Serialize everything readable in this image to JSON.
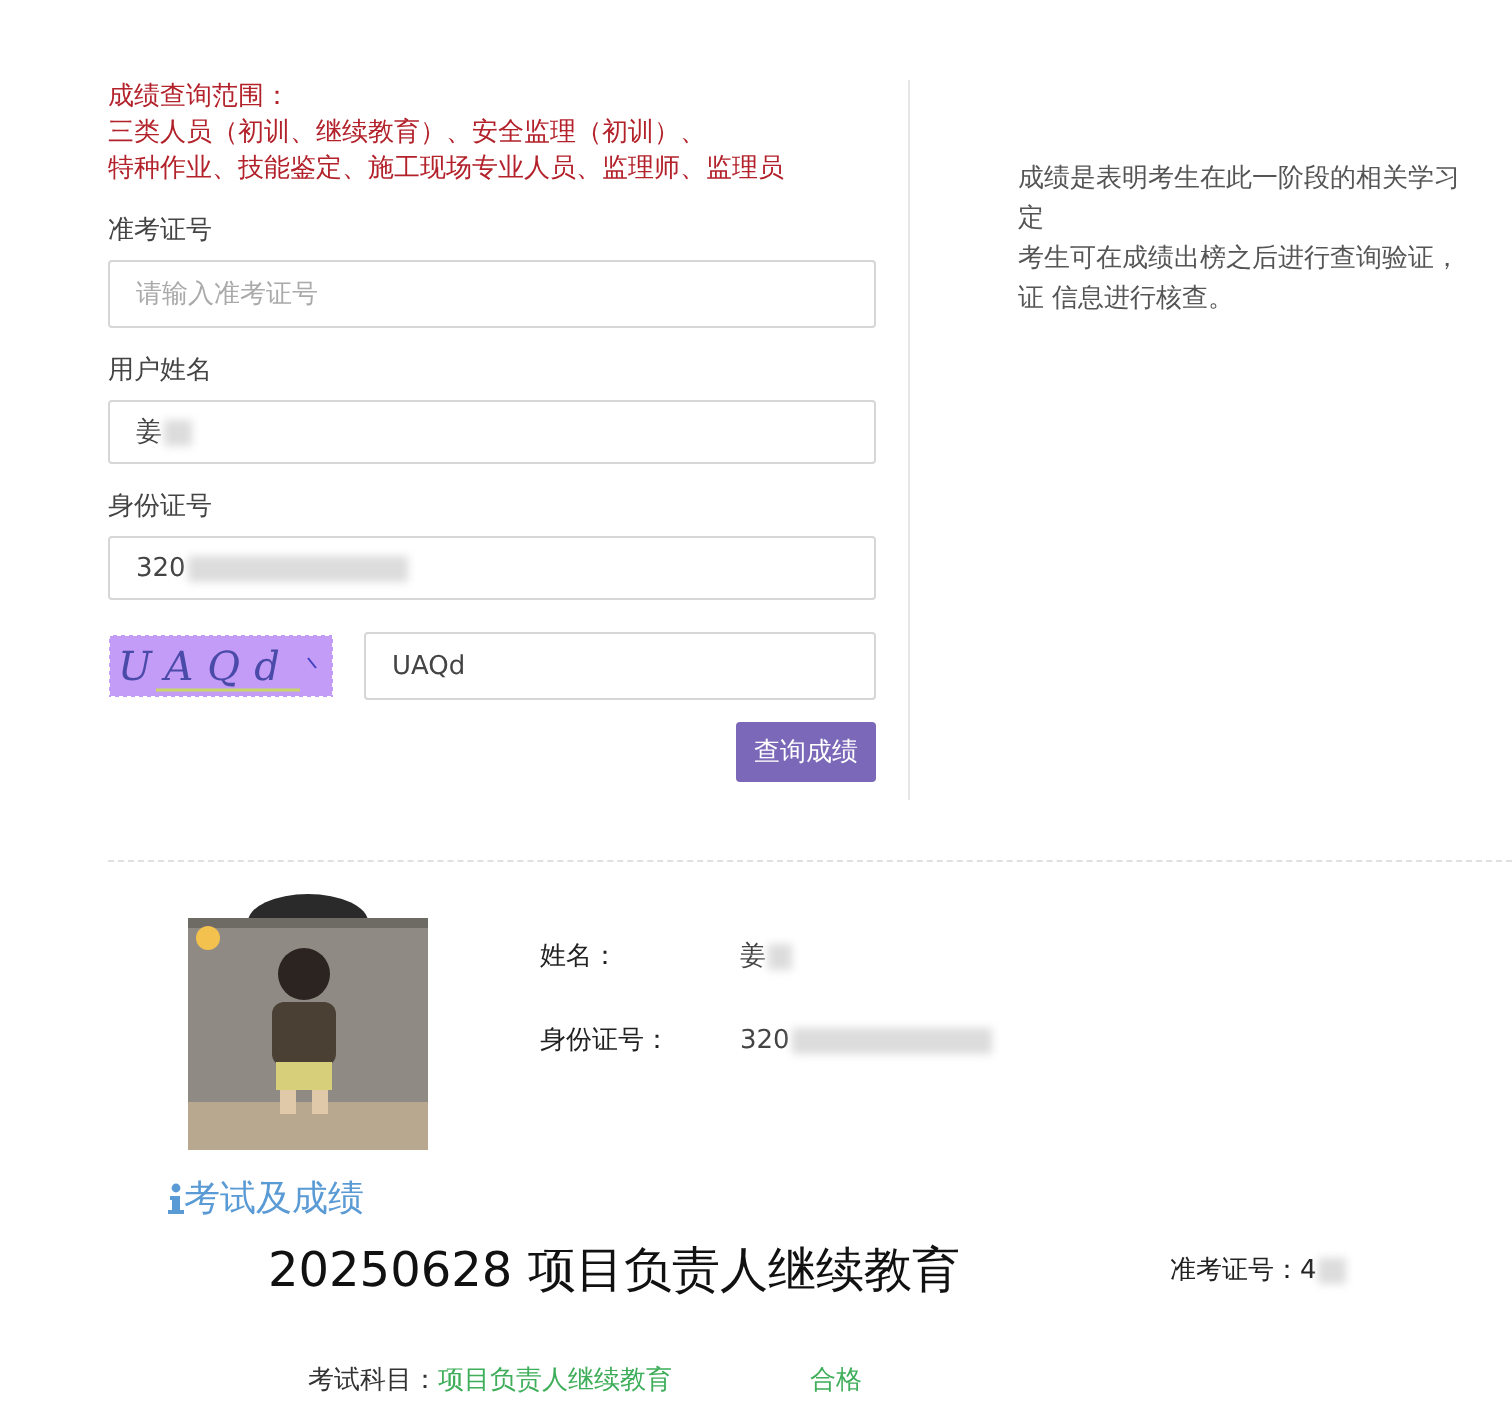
{
  "query_scope": {
    "title": "成绩查询范围：",
    "lines": [
      "三类人员（初训、继续教育）、安全监理（初训）、",
      "特种作业、技能鉴定、施工现场专业人员、监理师、监理员"
    ]
  },
  "fields": [
    {
      "label": "准考证号",
      "placeholder": "请输入准考证号"
    },
    {
      "label": "用户姓名",
      "value": "姜",
      "redacted": true
    },
    {
      "label": "身份证号",
      "value": "320",
      "redacted": true
    }
  ],
  "captcha": {
    "image_text": "UAQd",
    "value": "UAQd"
  },
  "submit_button": "查询成绩",
  "notice": [
    "成绩是表明考生在此一阶段的相关学习",
    "定",
    "考生可在成绩出榜之后进行查询验证，",
    "证 信息进行核查。"
  ],
  "profile": {
    "rows": [
      {
        "label": "姓名：",
        "value": "姜",
        "redacted": true
      },
      {
        "label": "身份证号：",
        "value": "320",
        "redacted": true
      }
    ]
  },
  "results": {
    "heading": "考试及成绩",
    "exam_title": "20250628 项目负责人继续教育",
    "ticket_label": "准考证号：",
    "ticket_value": "4",
    "ticket_redacted": true,
    "subjects": [
      {
        "label": "考试科目：",
        "name": "项目负责人继续教育",
        "result": "合格"
      }
    ]
  }
}
